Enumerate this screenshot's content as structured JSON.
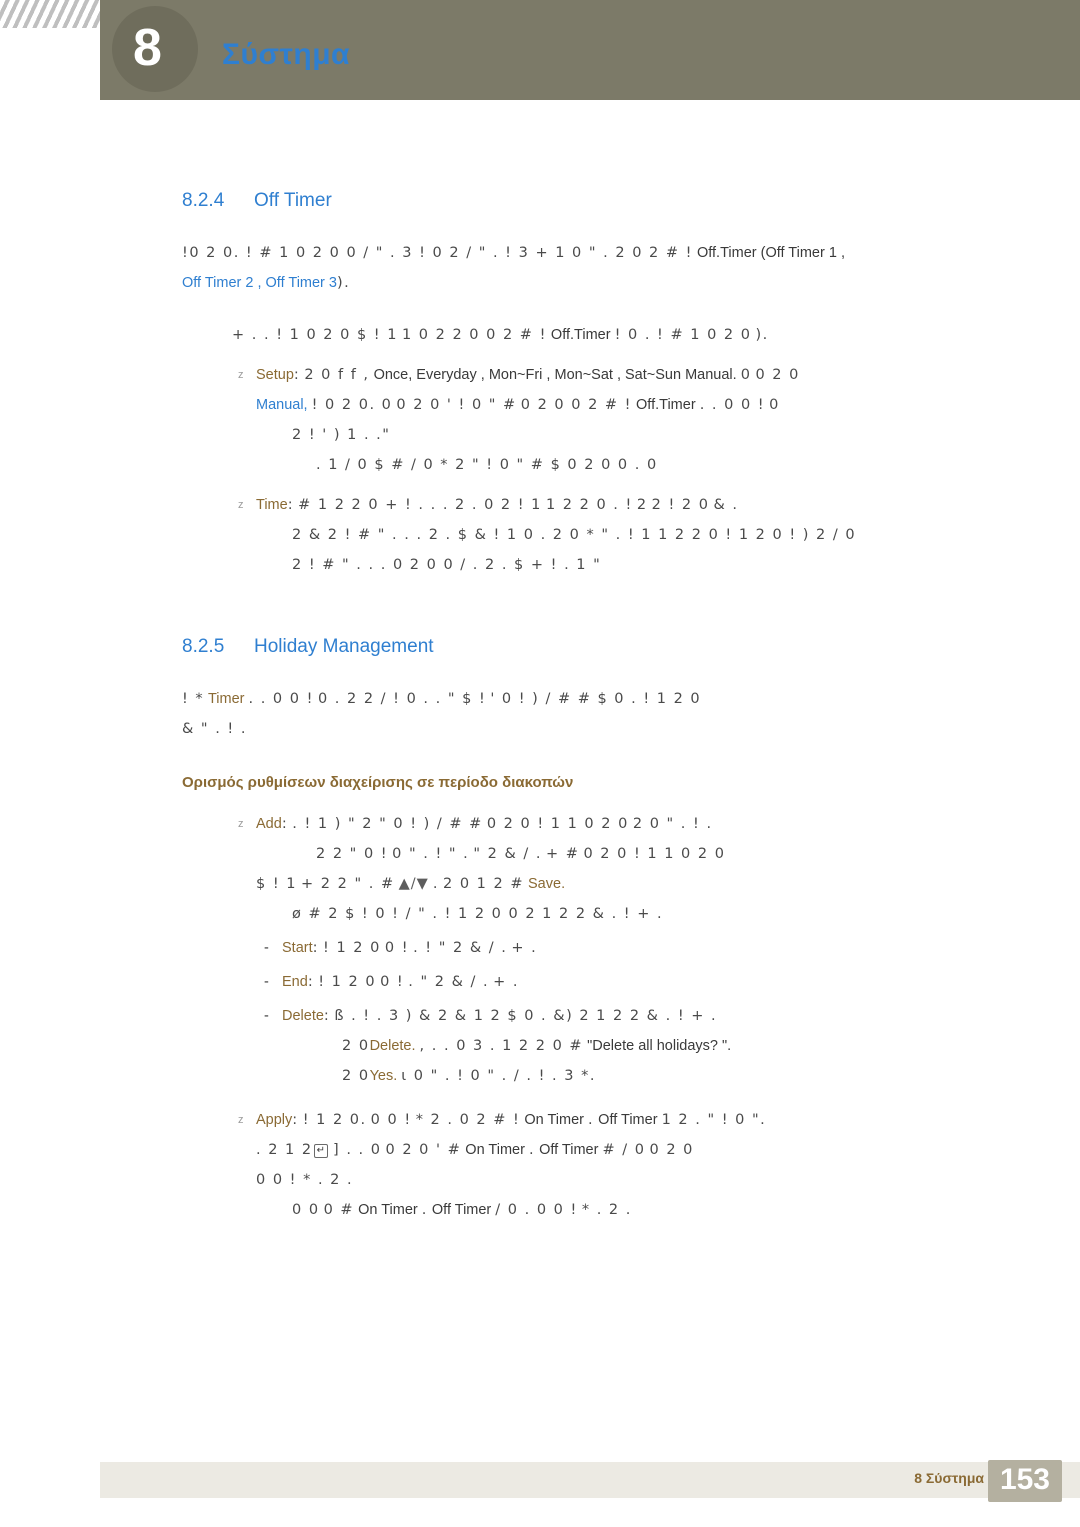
{
  "header": {
    "chapter_number": "8",
    "title": "Σύστημα"
  },
  "sections": [
    {
      "number": "8.2.4",
      "title": "Off Timer",
      "intro_line1": "!0  2 0. ! #      1 0 2 0 0 / \" . 3  ! 0 2  /  \" .   ! 3 + 1 0  \" . 2   0  2  # !",
      "intro_kw1": "Off.Timer",
      "intro_kw2": "(Off Timer 1 ,",
      "intro_line2_kw": "Off Timer 2 , Off Timer 3",
      "intro_line2_tail": ").",
      "para2_a": "+  . .     !  1 0 2 0  $ !   1",
      "para2_b": "1 0 2 2 0 0   2  # !",
      "para2_kw": "Off.Timer",
      "para2_c": "!    0    . ! #     1 0 2 0",
      "para2_d": ").",
      "bullets": [
        {
          "label": "Setup",
          "colon": ":",
          "text_a": "2 0 f f ,",
          "options": "Once, Everyday , Mon~Fri , Mon~Sat , Sat~Sun",
          "text_b": "Manual.",
          "text_c": "0",
          "text_d": "0 2 0",
          "line2_kw": "Manual,",
          "line2_a": "! 0  2 0. 0",
          "line2_b": "0 2 0 '  ! 0 \"  #",
          "line2_c": "0 2 0 0 2  # !",
          "line2_kw2": "Off.Timer",
          "line2_d": ". .  0  0 !",
          "line2_e": "0",
          "line3": "2  !  ' )  1 . .\"",
          "line4": ". 1   / 0   $ #  / 0   * 2  \"  ! 0 \"  #   $ 0 2 0 0    . 0"
        },
        {
          "label": "Time",
          "colon": ":",
          "text_a": "#      1 2 2 0  + ! .  . . 2 . 0  2  ! 1",
          "text_b": "1 2 2 0 . !",
          "text_c": "2",
          "text_d": "2 ! 2 0",
          "text_e": "& .",
          "line2": "2 &    2 !     # \"  . .   . 2 . $ & ! 1 0 . 2 0    * \" . ! 1         1 2 2 0 ! 1 2 0 ! ) 2 / 0",
          "line3": "2 !     # \" . . .     0 2 0 0 /    . 2 . $ + ! . 1  \""
        }
      ]
    },
    {
      "number": "8.2.5",
      "title": "Holiday Management",
      "intro_a": "! *",
      "intro_kw": "Timer",
      "intro_b": ". .  0  0 !",
      "intro_c": "0 . 2  2 /  ! 0 . . \" $ !",
      "intro_d": "' 0 ! ) / # #  $ 0 .  !  1 2 0",
      "intro_e": "& \" . !  .",
      "subheading": "Ορισμός ρυθμίσεων διαχείρισης σε περίοδο διακοπών",
      "bullets": [
        {
          "label": "Add",
          "colon": ":",
          "line1_a": ".    ! 1 ) \" 2  \" 0 ! ) /  # #",
          "line1_b": "0 2 0  ! 1   1 0 2 0",
          "line1_c": "2 0 \" . ! .",
          "line2_a": "2 2  \"  0 !",
          "line2_b": "0 \" . !  \"  .",
          "line2_c": "\" 2 & / .",
          "line2_d": "+    #",
          "line2_e": "0 2 0  ! 1   1 0 2 0",
          "line3_a": "$ ! 1",
          "line3_b": "+  2 2 \" . #",
          "line3_arrows": "▲/▼",
          "line3_c": ".",
          "line3_d": "2 0   1 2   #",
          "line3_kw": "Save.",
          "line4": "ø # 2  $ !      0 !  /  \" .  ! 1 2 0  0 2  1 2 2 & . !  + .",
          "sub_items": [
            {
              "label": "Start",
              "colon": ":",
              "text_a": "! 1 2 0",
              "text_b": "0 !",
              "text_c": ". ! \" 2 & / .",
              "text_d": "+ ."
            },
            {
              "label": "End",
              "colon": ":",
              "text_a": "! 1 2 0",
              "text_b": "0 !",
              "text_c": ".    \" 2 & / .",
              "text_d": "+ ."
            },
            {
              "label": "Delete",
              "colon": ":",
              "text_a": "ß  . ! . 3 ) & 2 & 1 2  $ 0 . &) 2   1 2 2 & . !  + .",
              "line2_a": "2 0",
              "line2_kw": "Delete.",
              "line2_b": ", . .  0 3 .  1 2 2 0   #",
              "line2_quote": "\"Delete all holidays?  \".",
              "line3_a": "2 0",
              "line3_kw": "Yes.",
              "line3_b": "ι  0 \"  . !  0 \" . /  . ! . 3  *."
            }
          ]
        },
        {
          "label": "Apply",
          "colon": ":",
          "line1_a": "! 1 2 0.",
          "line1_b": "0  0 !",
          "line1_c": "*  2 . 0  2  # !",
          "line1_kw1": "On Timer",
          "line1_d": ".",
          "line1_kw2": "Off Timer",
          "line1_e": "1 2  . \" !   0 \".",
          "line2_a": ". 2  1 2",
          "line2_b": "] . .  0",
          "line2_c": "0 2 0 '  #",
          "line2_kw1": "On Timer",
          "line2_d": ".",
          "line2_kw2": "Off Timer",
          "line2_e": "# / 0",
          "line2_f": "0 2 0",
          "line3": "0  0 !           * . 2 .",
          "line4_a": "0   0",
          "line4_b": "0 #",
          "line4_kw1": "On Timer",
          "line4_c": ".",
          "line4_kw2": "Off Timer",
          "line4_d": "/ 0   .  0  0 !",
          "line4_e": "* . 2 ."
        }
      ]
    }
  ],
  "footer": {
    "chapter_label": "8 Σύστημα",
    "page_number": "153"
  }
}
